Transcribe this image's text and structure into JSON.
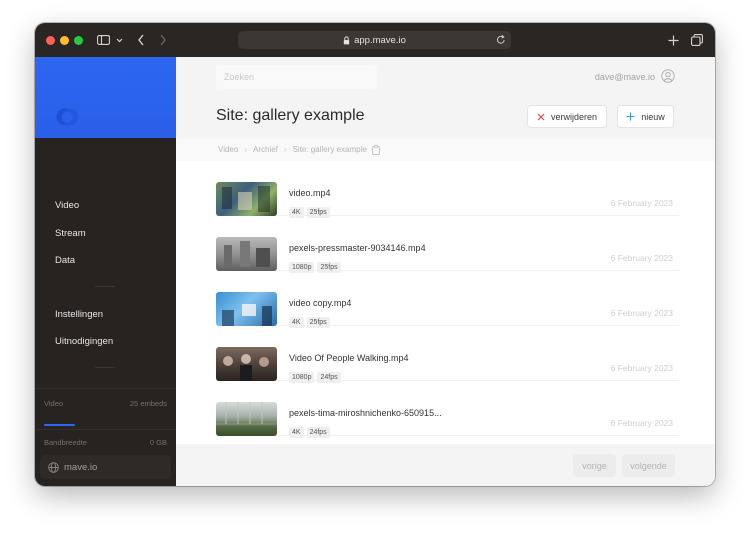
{
  "browser": {
    "url": "app.mave.io"
  },
  "sidebar": {
    "nav": [
      {
        "label": "Video"
      },
      {
        "label": "Stream"
      },
      {
        "label": "Data"
      },
      {
        "label": "Instellingen"
      },
      {
        "label": "Uitnodigingen"
      }
    ],
    "stats": [
      {
        "label": "Video",
        "value": "25 embeds"
      },
      {
        "label": "Bandbreedte",
        "value": "0 GB"
      }
    ],
    "site": "mave.io",
    "accent": "#2d66f2"
  },
  "header": {
    "search_placeholder": "Zoeken",
    "user_email": "dave@mave.io"
  },
  "page": {
    "title": "Site: gallery example",
    "delete_label": "verwijderen",
    "new_label": "nieuw"
  },
  "breadcrumb": [
    "Video",
    "Archief",
    "Site: gallery example"
  ],
  "videos": [
    {
      "name": "video.mp4",
      "tags": [
        "4K",
        "25fps"
      ],
      "date": "6 February 2023"
    },
    {
      "name": "pexels-pressmaster-9034146.mp4",
      "tags": [
        "1080p",
        "25fps"
      ],
      "date": "6 February 2023"
    },
    {
      "name": "video copy.mp4",
      "tags": [
        "4K",
        "25fps"
      ],
      "date": "6 February 2023"
    },
    {
      "name": "Video Of People Walking.mp4",
      "tags": [
        "1080p",
        "24fps"
      ],
      "date": "6 February 2023"
    },
    {
      "name": "pexels-tima-miroshnichenko-650915...",
      "tags": [
        "4K",
        "24fps"
      ],
      "date": "6 February 2023"
    }
  ],
  "pagination": {
    "prev": "vorige",
    "next": "volgende"
  }
}
